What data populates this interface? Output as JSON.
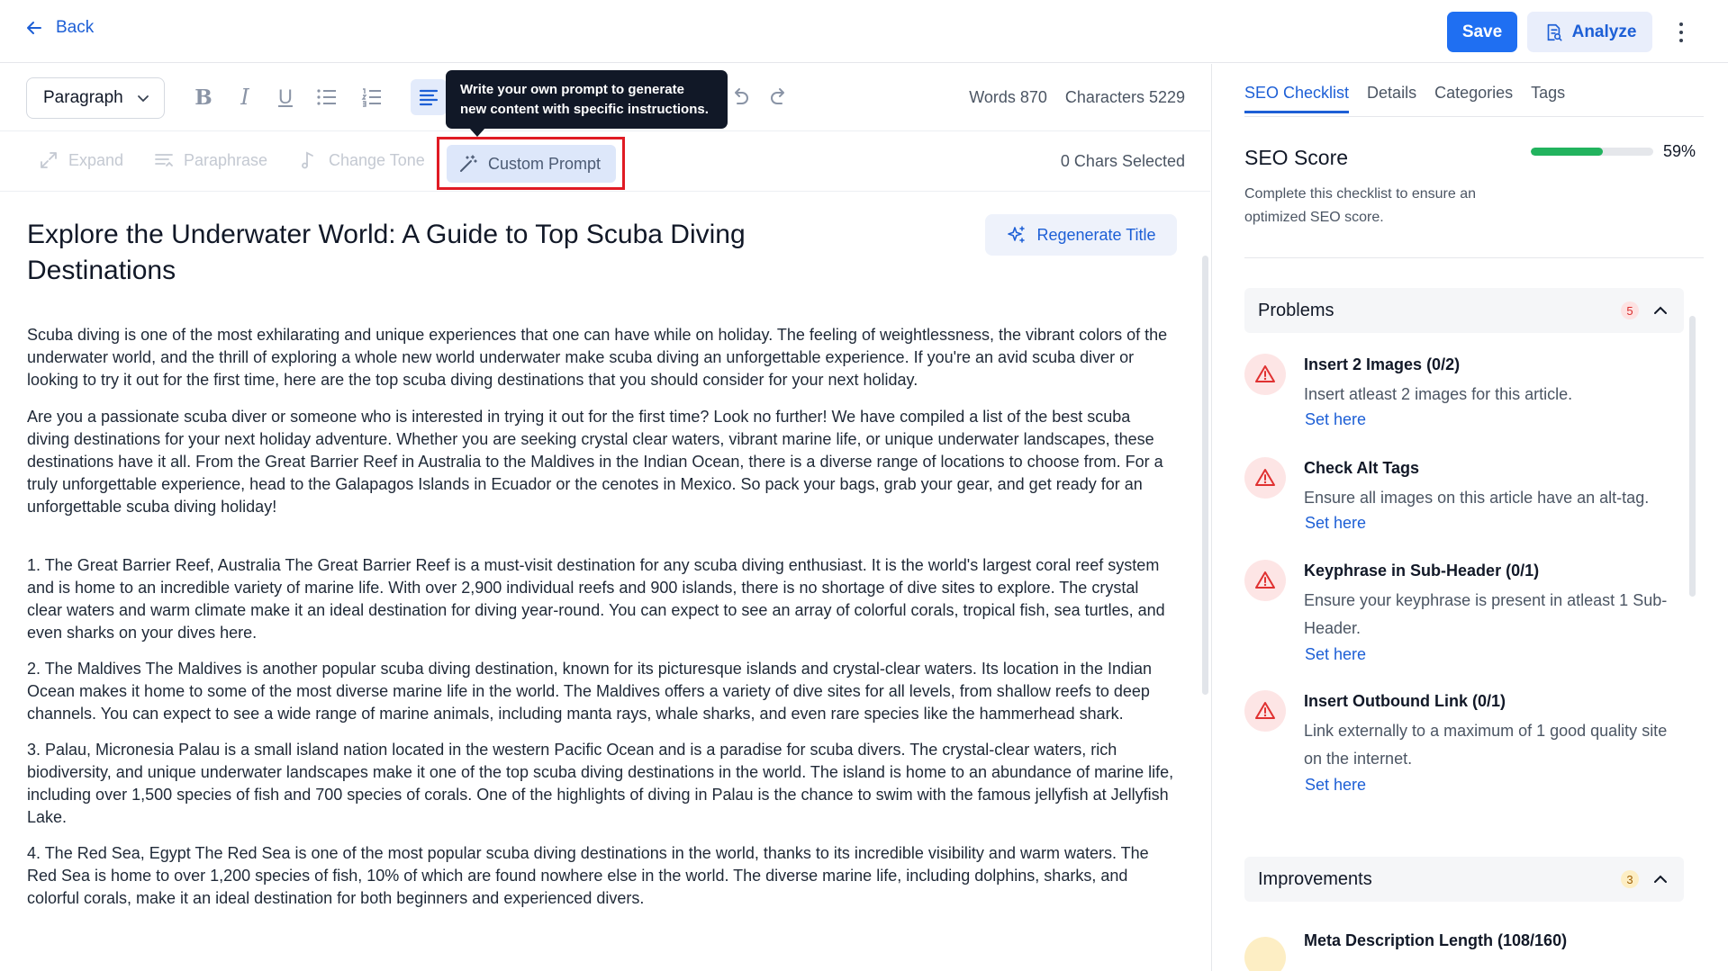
{
  "header": {
    "back_label": "Back",
    "save_label": "Save",
    "analyze_label": "Analyze"
  },
  "toolbar": {
    "format_select": "Paragraph",
    "words_label": "Words 870",
    "characters_label": "Characters 5229",
    "tooltip": "Write your own prompt to generate new content with specific instructions.",
    "ai_tools": {
      "expand": "Expand",
      "paraphrase": "Paraphrase",
      "change_tone": "Change Tone",
      "custom_prompt": "Custom Prompt"
    },
    "chars_selected": "0 Chars Selected"
  },
  "article": {
    "title": "Explore the Underwater World: A Guide to Top Scuba Diving Destinations",
    "regenerate_label": "Regenerate Title",
    "paragraphs": [
      "Scuba diving is one of the most exhilarating and unique experiences that one can have while on holiday. The feeling of weightlessness, the vibrant colors of the underwater world, and the thrill of exploring a whole new world underwater make scuba diving an unforgettable experience. If you're an avid scuba diver or looking to try it out for the first time, here are the top scuba diving destinations that you should consider for your next holiday.",
      "Are you a passionate scuba diver or someone who is interested in trying it out for the first time? Look no further! We have compiled a list of the best scuba diving destinations for your next holiday adventure. Whether you are seeking crystal clear waters, vibrant marine life, or unique underwater landscapes, these destinations have it all. From the Great Barrier Reef in Australia to the Maldives in the Indian Ocean, there is a diverse range of locations to choose from. For a truly unforgettable experience, head to the Galapagos Islands in Ecuador or the cenotes in Mexico. So pack your bags, grab your gear, and get ready for an unforgettable scuba diving holiday!",
      "1. The Great Barrier Reef, Australia The Great Barrier Reef is a must-visit destination for any scuba diving enthusiast. It is the world's largest coral reef system and is home to an incredible variety of marine life. With over 2,900 individual reefs and 900 islands, there is no shortage of dive sites to explore. The crystal clear waters and warm climate make it an ideal destination for diving year-round. You can expect to see an array of colorful corals, tropical fish, sea turtles, and even sharks on your dives here.",
      "2. The Maldives The Maldives is another popular scuba diving destination, known for its picturesque islands and crystal-clear waters. Its location in the Indian Ocean makes it home to some of the most diverse marine life in the world. The Maldives offers a variety of dive sites for all levels, from shallow reefs to deep channels. You can expect to see a wide range of marine animals, including manta rays, whale sharks, and even rare species like the hammerhead shark.",
      "3. Palau, Micronesia Palau is a small island nation located in the western Pacific Ocean and is a paradise for scuba divers. The crystal-clear waters, rich biodiversity, and unique underwater landscapes make it one of the top scuba diving destinations in the world. The island is home to an abundance of marine life, including over 1,500 species of fish and 700 species of corals. One of the highlights of diving in Palau is the chance to swim with the famous jellyfish at Jellyfish Lake.",
      "4. The Red Sea, Egypt The Red Sea is one of the most popular scuba diving destinations in the world, thanks to its incredible visibility and warm waters. The Red Sea is home to over 1,200 species of fish, 10% of which are found nowhere else in the world. The diverse marine life, including dolphins, sharks, and colorful corals, make it an ideal destination for both beginners and experienced divers."
    ]
  },
  "panel": {
    "tabs": [
      "SEO Checklist",
      "Details",
      "Categories",
      "Tags"
    ],
    "seo_title": "SEO Score",
    "seo_score_percent": 59,
    "seo_score_label": "59%",
    "seo_desc": "Complete this checklist to ensure an optimized SEO score.",
    "problems": {
      "title": "Problems",
      "count": "5",
      "items": [
        {
          "title": "Insert 2 Images (0/2)",
          "desc": "Insert atleast 2 images for this article.",
          "link": "Set here"
        },
        {
          "title": "Check Alt Tags",
          "desc": "Ensure all images on this article have an alt-tag.",
          "link": "Set here"
        },
        {
          "title": "Keyphrase in Sub-Header (0/1)",
          "desc": "Ensure your keyphrase is present in atleast 1 Sub-Header.",
          "link": "Set here"
        },
        {
          "title": "Insert Outbound Link (0/1)",
          "desc": "Link externally to a maximum of 1 good quality site on the internet.",
          "link": "Set here"
        }
      ]
    },
    "improvements": {
      "title": "Improvements",
      "count": "3",
      "first_item": "Meta Description Length (108/160)"
    }
  },
  "colors": {
    "accent": "#1f6ff2",
    "score_green": "#22b35e",
    "problem_red": "#e03131",
    "highlight_frame": "#e01b24"
  }
}
